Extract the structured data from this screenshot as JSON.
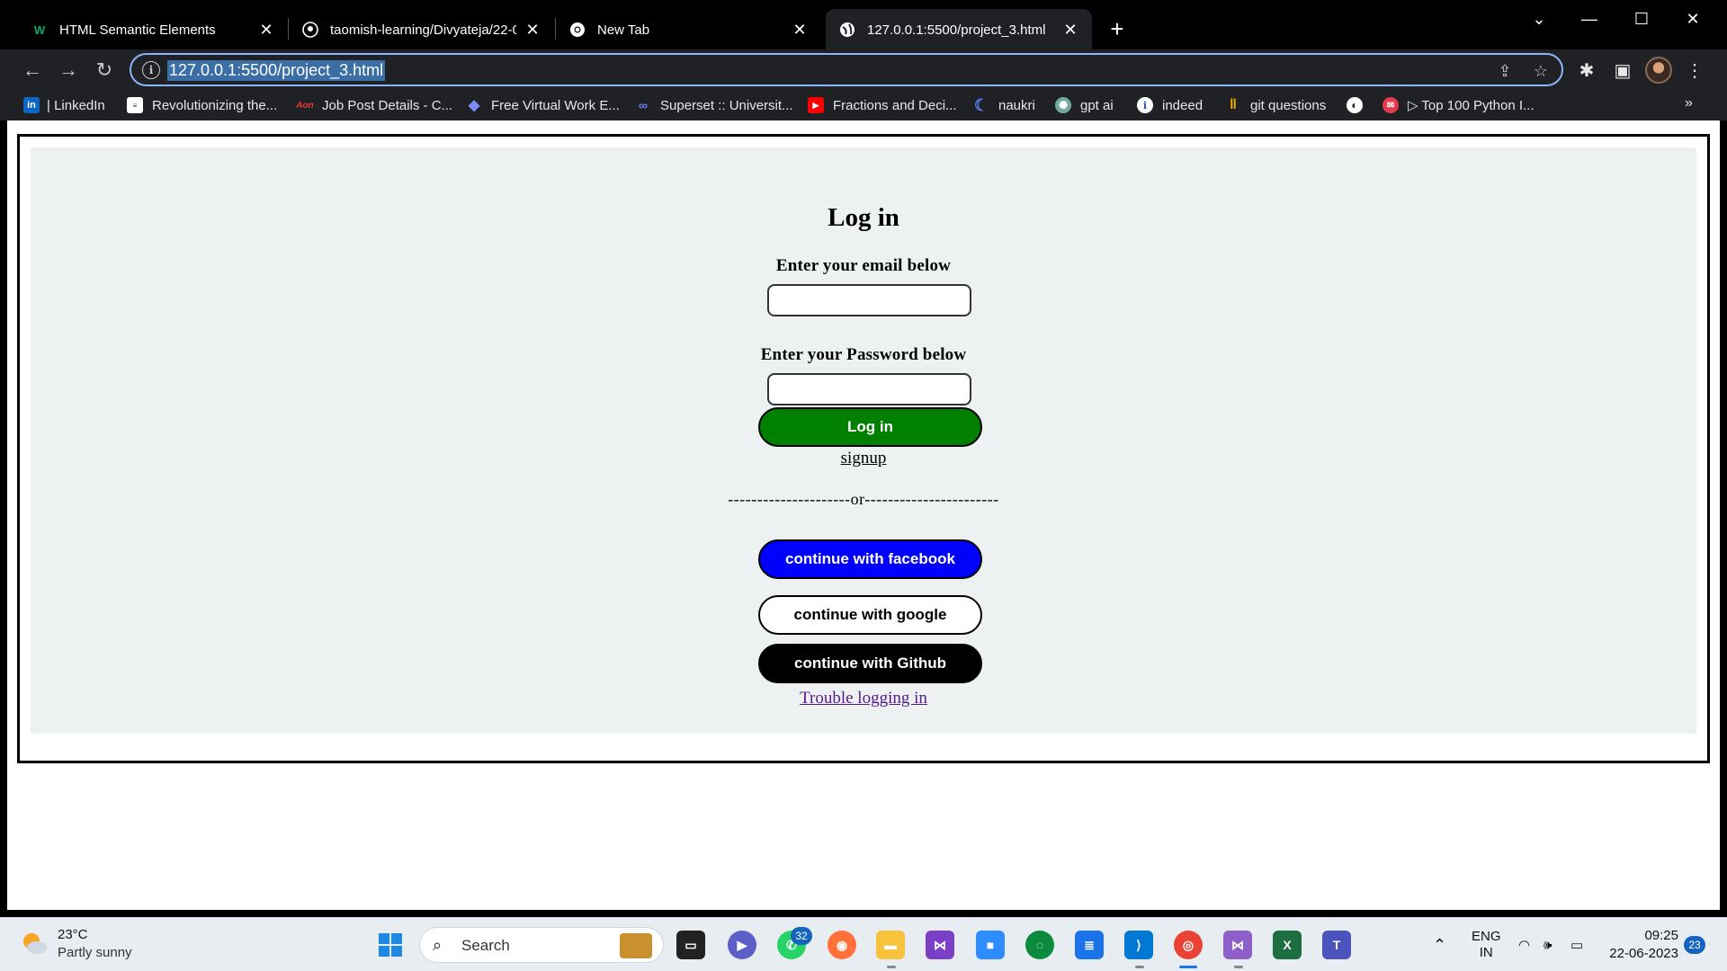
{
  "browser": {
    "tabs": [
      {
        "title": "HTML Semantic Elements",
        "icon": "w3schools-icon",
        "active": false
      },
      {
        "title": "taomish-learning/Divyateja/22-0",
        "icon": "github-icon",
        "active": false
      },
      {
        "title": "New Tab",
        "icon": "chrome-icon",
        "active": false
      },
      {
        "title": "127.0.0.1:5500/project_3.html",
        "icon": "globe-icon",
        "active": true
      }
    ],
    "url": "127.0.0.1:5500/project_3.html",
    "bookmarks": [
      "| LinkedIn",
      "Revolutionizing the...",
      "Job Post Details - C...",
      "Free Virtual Work E...",
      "Superset :: Universit...",
      "Fractions and Deci...",
      "naukri",
      "gpt ai",
      "indeed",
      "git questions",
      "",
      "▷ Top 100 Python I..."
    ],
    "bookmarks_overflow": "»"
  },
  "page": {
    "heading": "Log in",
    "email_label": "Enter your email below",
    "email_value": "",
    "password_label": "Enter your Password below",
    "password_value": "",
    "login_button": "Log in",
    "signup_link": "signup",
    "divider": "---------------------or-----------------------",
    "facebook_button": "continue with facebook",
    "google_button": "continue with google",
    "github_button": "continue with Github",
    "trouble_link": "Trouble logging in",
    "colors": {
      "panel_bg": "#edf1f2",
      "login_bg": "#008000",
      "facebook_bg": "#0000ff",
      "github_bg": "#000000",
      "visited_link": "#551a8b"
    }
  },
  "taskbar": {
    "weather_temp": "23°C",
    "weather_desc": "Partly sunny",
    "search_placeholder": "Search",
    "whatsapp_badge": "32",
    "language": "ENG",
    "region": "IN",
    "time": "09:25",
    "date": "22-06-2023",
    "notification_count": "23"
  }
}
